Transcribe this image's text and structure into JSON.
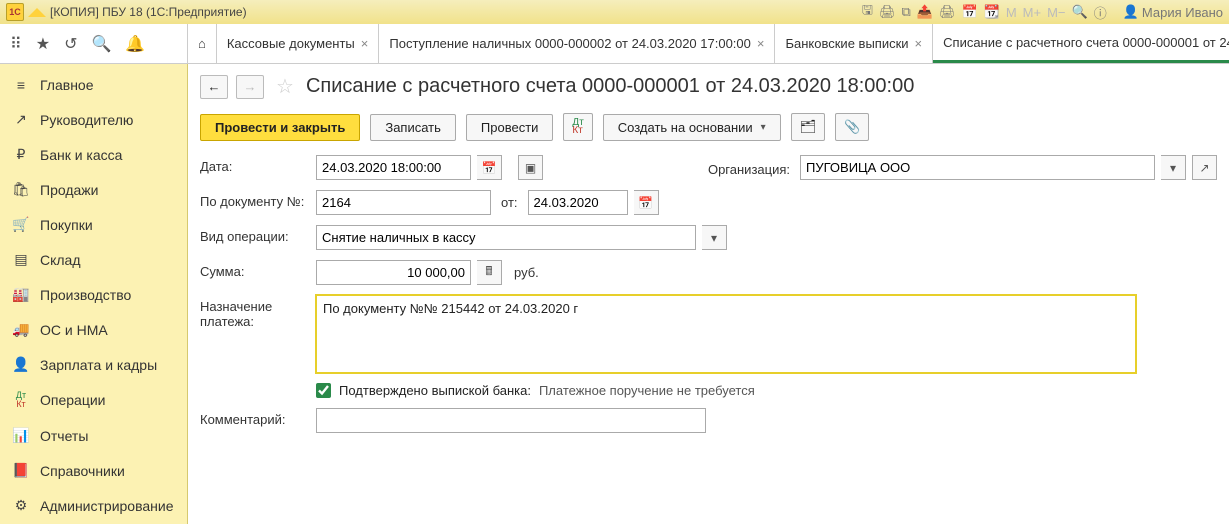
{
  "titlebar": {
    "title": "[КОПИЯ] ПБУ 18  (1С:Предприятие)",
    "user_label": "Мария Ивано"
  },
  "tabs": [
    {
      "label": "Кассовые документы",
      "closable": true
    },
    {
      "label": "Поступление наличных 0000-000002 от 24.03.2020 17:00:00",
      "closable": true
    },
    {
      "label": "Банковские выписки",
      "closable": true
    },
    {
      "label": "Списание с расчетного счета 0000-000001 от 24",
      "closable": false,
      "active": true
    }
  ],
  "sidebar": {
    "items": [
      {
        "icon": "≡",
        "label": "Главное"
      },
      {
        "icon": "↗",
        "label": "Руководителю"
      },
      {
        "icon": "₽",
        "label": "Банк и касса"
      },
      {
        "icon": "🛍",
        "label": "Продажи"
      },
      {
        "icon": "🛒",
        "label": "Покупки"
      },
      {
        "icon": "▤",
        "label": "Склад"
      },
      {
        "icon": "🏭",
        "label": "Производство"
      },
      {
        "icon": "🚚",
        "label": "ОС и НМА"
      },
      {
        "icon": "👤",
        "label": "Зарплата и кадры"
      },
      {
        "icon": "ДтКт",
        "label": "Операции"
      },
      {
        "icon": "📊",
        "label": "Отчеты"
      },
      {
        "icon": "📕",
        "label": "Справочники"
      },
      {
        "icon": "⚙",
        "label": "Администрирование"
      }
    ]
  },
  "document": {
    "title": "Списание с расчетного счета 0000-000001 от 24.03.2020 18:00:00",
    "buttons": {
      "post_close": "Провести и закрыть",
      "write": "Записать",
      "post": "Провести",
      "create_based": "Создать на основании"
    },
    "fields": {
      "date_label": "Дата:",
      "date_value": "24.03.2020 18:00:00",
      "org_label": "Организация:",
      "org_value": "ПУГОВИЦА ООО",
      "docnum_label": "По документу №:",
      "docnum_value": "2164",
      "from_label": "от:",
      "from_value": "24.03.2020",
      "optype_label": "Вид операции:",
      "optype_value": "Снятие наличных в кассу",
      "amount_label": "Сумма:",
      "amount_value": "10 000,00",
      "amount_currency": "руб.",
      "purpose_label": "Назначение платежа:",
      "purpose_value": "По документу №№ 215442 от 24.03.2020 г",
      "confirm_label": "Подтверждено выпиской банка:",
      "confirm_hint": "Платежное поручение не требуется",
      "comment_label": "Комментарий:",
      "comment_value": ""
    }
  }
}
